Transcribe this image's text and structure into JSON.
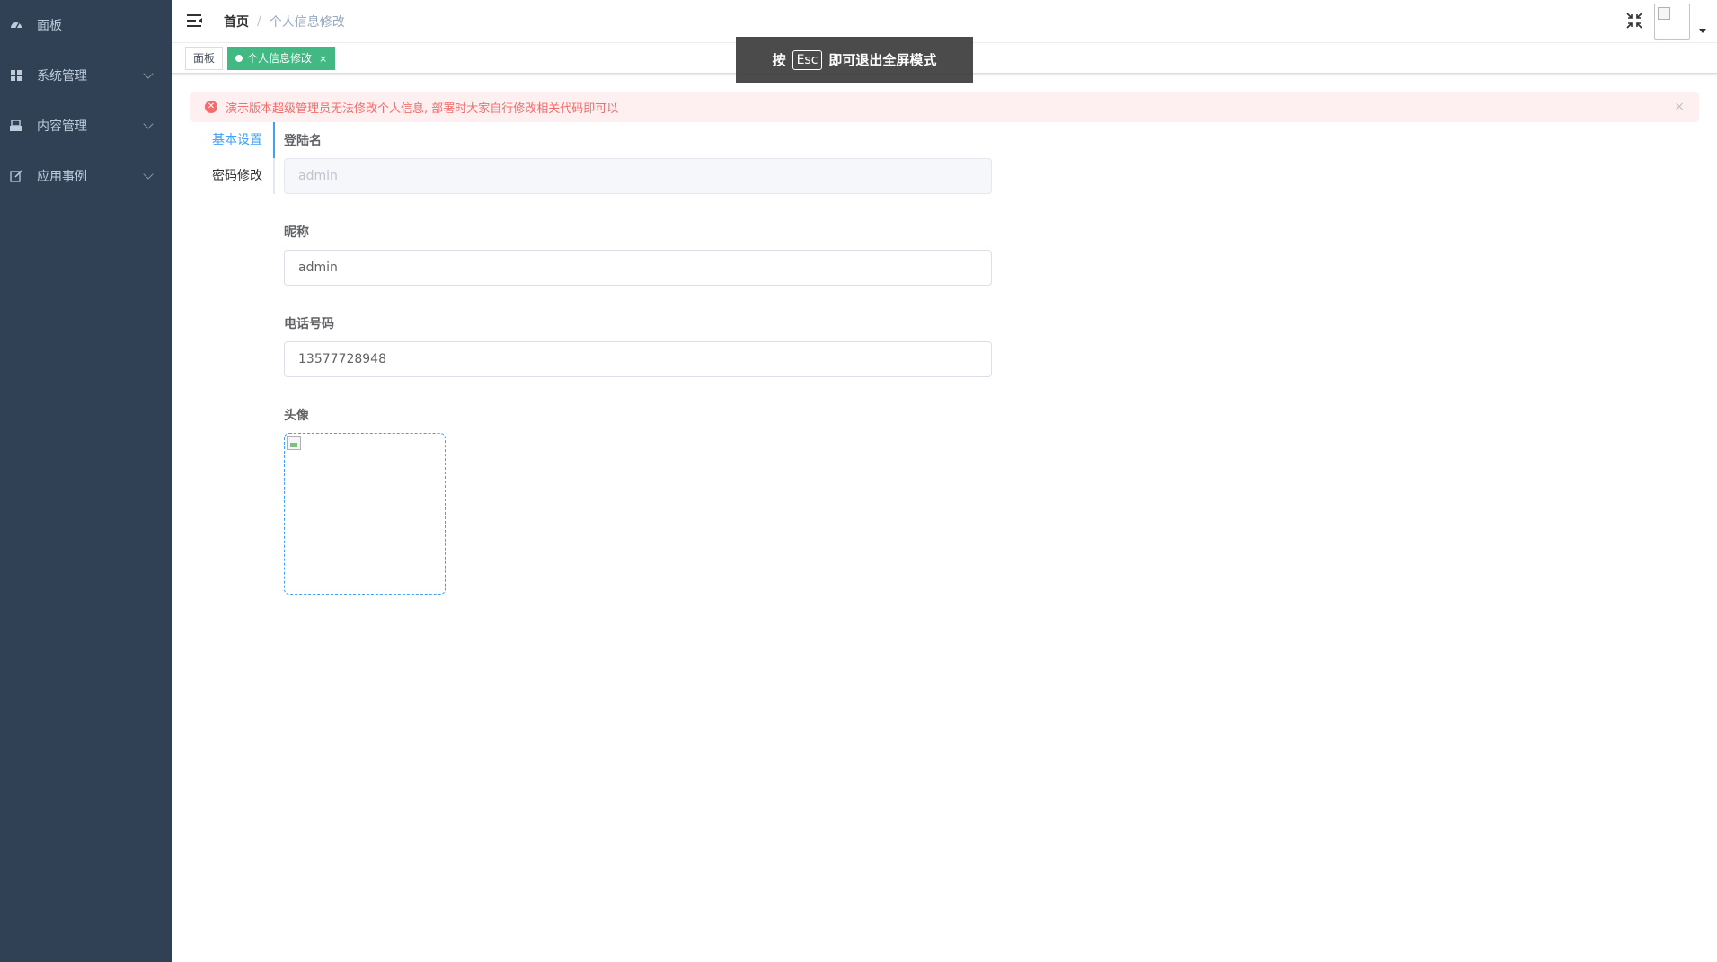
{
  "sidebar": {
    "items": [
      {
        "label": "面板",
        "icon": "dashboard-icon",
        "expandable": false
      },
      {
        "label": "系统管理",
        "icon": "grid-icon",
        "expandable": true
      },
      {
        "label": "内容管理",
        "icon": "content-icon",
        "expandable": true
      },
      {
        "label": "应用事例",
        "icon": "edit-icon",
        "expandable": true
      }
    ]
  },
  "header": {
    "breadcrumb": {
      "home": "首页",
      "separator": "/",
      "current": "个人信息修改"
    }
  },
  "tags": {
    "items": [
      {
        "label": "面板",
        "active": false
      },
      {
        "label": "个人信息修改",
        "active": true,
        "close": "×"
      }
    ]
  },
  "fullscreen_toast": {
    "prefix": "按",
    "key": "Esc",
    "suffix": "即可退出全屏模式"
  },
  "alert": {
    "message": "演示版本超级管理员无法修改个人信息, 部署时大家自行修改相关代码即可以",
    "close": "×",
    "type": "error",
    "color": "#f56c6c"
  },
  "tabs": {
    "items": [
      {
        "label": "基本设置",
        "active": true
      },
      {
        "label": "密码修改",
        "active": false
      }
    ]
  },
  "form": {
    "username": {
      "label": "登陆名",
      "value": "admin",
      "disabled": true
    },
    "nickname": {
      "label": "昵称",
      "value": "admin"
    },
    "phone": {
      "label": "电话号码",
      "value": "13577728948"
    },
    "avatar": {
      "label": "头像"
    }
  },
  "colors": {
    "sidebar_bg": "#304156",
    "accent": "#409eff",
    "tag_active": "#42b983"
  }
}
